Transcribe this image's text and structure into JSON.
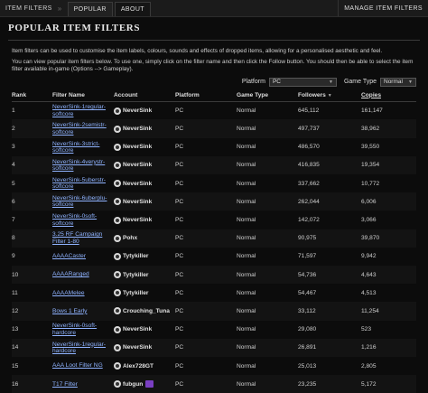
{
  "topbar": {
    "breadcrumb": "Item Filters",
    "separator": "»",
    "tabs": [
      {
        "label": "Popular"
      },
      {
        "label": "About"
      }
    ],
    "manage": "Manage Item Filters"
  },
  "page_title": "Popular Item Filters",
  "intro": {
    "p1": "Item filters can be used to customise the item labels, colours, sounds and effects of dropped items, allowing for a personalised aesthetic and feel.",
    "p2": "You can view popular item filters below. To use one, simply click on the filter name and then click the Follow button. You should then be able to select the item filter available in-game (Options --> Gameplay)."
  },
  "filters": {
    "platform_label": "Platform",
    "platform_value": "PC",
    "gametype_label": "Game Type",
    "gametype_value": "Normal"
  },
  "table": {
    "headers": {
      "rank": "Rank",
      "name": "Filter Name",
      "account": "Account",
      "platform": "Platform",
      "gametype": "Game Type",
      "followers": "Followers",
      "copies": "Copies"
    },
    "rows": [
      {
        "rank": "1",
        "name": "NeverSink-1regular-softcore",
        "account": "NeverSink",
        "platform": "PC",
        "gametype": "Normal",
        "followers": "645,112",
        "copies": "161,147"
      },
      {
        "rank": "2",
        "name": "NeverSink-2semistr-softcore",
        "account": "NeverSink",
        "platform": "PC",
        "gametype": "Normal",
        "followers": "497,737",
        "copies": "38,962"
      },
      {
        "rank": "3",
        "name": "NeverSink-3strict-softcore",
        "account": "NeverSink",
        "platform": "PC",
        "gametype": "Normal",
        "followers": "486,570",
        "copies": "39,550"
      },
      {
        "rank": "4",
        "name": "NeverSink-4verystr-softcore",
        "account": "NeverSink",
        "platform": "PC",
        "gametype": "Normal",
        "followers": "416,835",
        "copies": "19,354"
      },
      {
        "rank": "5",
        "name": "NeverSink-5uberstr-softcore",
        "account": "NeverSink",
        "platform": "PC",
        "gametype": "Normal",
        "followers": "337,662",
        "copies": "10,772"
      },
      {
        "rank": "6",
        "name": "NeverSink-6uberplu-softcore",
        "account": "NeverSink",
        "platform": "PC",
        "gametype": "Normal",
        "followers": "262,044",
        "copies": "6,006"
      },
      {
        "rank": "7",
        "name": "NeverSink-0soft-softcore",
        "account": "NeverSink",
        "platform": "PC",
        "gametype": "Normal",
        "followers": "142,072",
        "copies": "3,066"
      },
      {
        "rank": "8",
        "name": "3.25 RF Campaign Filter 1-80",
        "account": "Pohx",
        "platform": "PC",
        "gametype": "Normal",
        "followers": "90,975",
        "copies": "39,870"
      },
      {
        "rank": "9",
        "name": "AAAACaster",
        "account": "Tytykiller",
        "platform": "PC",
        "gametype": "Normal",
        "followers": "71,597",
        "copies": "9,942"
      },
      {
        "rank": "10",
        "name": "AAAARanged",
        "account": "Tytykiller",
        "platform": "PC",
        "gametype": "Normal",
        "followers": "54,736",
        "copies": "4,643"
      },
      {
        "rank": "11",
        "name": "AAAAMelee",
        "account": "Tytykiller",
        "platform": "PC",
        "gametype": "Normal",
        "followers": "54,467",
        "copies": "4,513"
      },
      {
        "rank": "12",
        "name": "Bows 1 Early",
        "account": "Crouching_Tuna",
        "platform": "PC",
        "gametype": "Normal",
        "followers": "33,112",
        "copies": "11,254"
      },
      {
        "rank": "13",
        "name": "NeverSink-0soft-hardcore",
        "account": "NeverSink",
        "platform": "PC",
        "gametype": "Normal",
        "followers": "29,080",
        "copies": "523"
      },
      {
        "rank": "14",
        "name": "NeverSink-1regular-hardcore",
        "account": "NeverSink",
        "platform": "PC",
        "gametype": "Normal",
        "followers": "26,891",
        "copies": "1,216"
      },
      {
        "rank": "15",
        "name": "AAA Loot Filter NG",
        "account": "Alex728GT",
        "platform": "PC",
        "gametype": "Normal",
        "followers": "25,013",
        "copies": "2,805"
      },
      {
        "rank": "16",
        "name": "T17 Filter",
        "account": "fubgun",
        "platform": "PC",
        "gametype": "Normal",
        "followers": "23,235",
        "copies": "5,172"
      }
    ]
  },
  "icons": {
    "avatar": "account-avatar-icon",
    "twitch": "twitch-icon",
    "sort": "sort-desc-icon",
    "dropdown": "chevron-down-icon"
  },
  "colors": {
    "link": "#8fb3ff",
    "background": "#0c0c0c",
    "twitch": "#7a3fc2"
  }
}
